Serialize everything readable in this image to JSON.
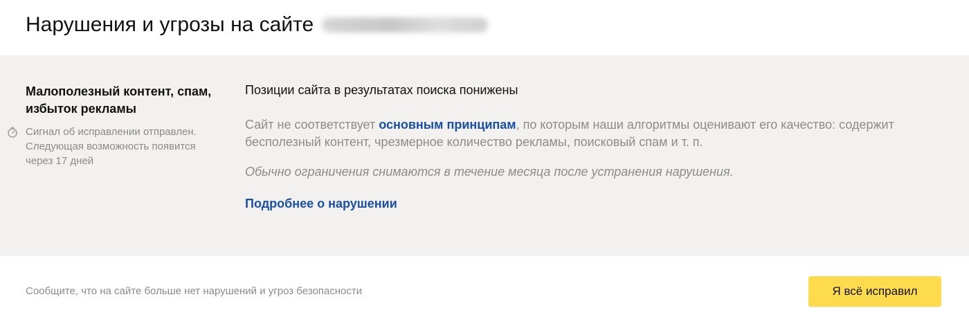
{
  "header": {
    "title": "Нарушения и угрозы на сайте"
  },
  "violation": {
    "name": "Малополезный контент, спам, избыток рекламы",
    "status_icon": "timer-icon",
    "status_text": "Сигнал об исправлении отправлен. Следующая возможность появится через 17 дней"
  },
  "details": {
    "heading": "Позиции сайта в результатах поиска понижены",
    "desc_before_link": "Сайт не соответствует ",
    "desc_link": "основным принципам",
    "desc_after_link": ", по которым наши алгоритмы оценивают его качество: содержит бесполезный контент, чрезмерное количество рекламы, поисковый спам и т. п.",
    "note": "Обычно ограничения снимаются в течение месяца после устранения нарушения.",
    "more_link": "Подробнее о нарушении"
  },
  "footer": {
    "text": "Сообщите, что на сайте больше нет нарушений и угроз безопасности",
    "button_label": "Я всё исправил"
  },
  "colors": {
    "panel_bg": "#f2f1f0",
    "link": "#1a4fa3",
    "button_bg": "#fedb4d",
    "muted_text": "#8a8a8a"
  }
}
